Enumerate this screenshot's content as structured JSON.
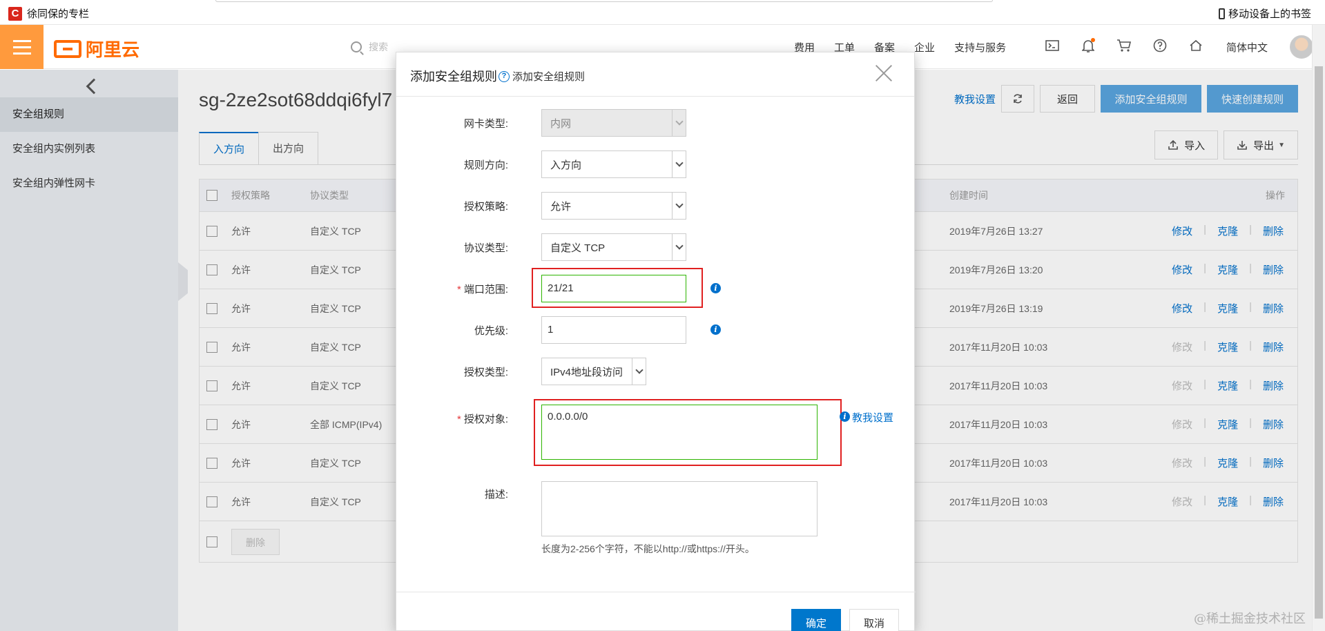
{
  "bookmarks": {
    "folder_label": "徐同保的专栏",
    "logo_letter": "C",
    "mobile_bookmarks": "移动设备上的书签"
  },
  "topnav": {
    "brand": "阿里云",
    "search_placeholder": "搜索",
    "links": [
      "费用",
      "工单",
      "备案",
      "企业",
      "支持与服务"
    ],
    "lang": "简体中文",
    "accent": "#ff6a00",
    "menu_bg": "#ff9a3d"
  },
  "sidebar": {
    "items": [
      "安全组规则",
      "安全组内实例列表",
      "安全组内弹性网卡"
    ],
    "active_index": 0
  },
  "main": {
    "sg_id": "sg-2ze2sot68ddqi6fyl7",
    "teach_link": "教我设置",
    "back_label": "返回",
    "add_rule_label": "添加安全组规则",
    "quick_rule_label": "快速创建规则",
    "tabs": [
      "入方向",
      "出方向"
    ],
    "import_label": "导入",
    "export_label": "导出",
    "columns": {
      "policy": "授权策略",
      "protocol": "协议类型",
      "created": "创建时间",
      "ops": "操作"
    },
    "rows": [
      {
        "policy": "允许",
        "protocol": "自定义 TCP",
        "created": "2019年7月26日 13:27",
        "edit_enabled": true
      },
      {
        "policy": "允许",
        "protocol": "自定义 TCP",
        "created": "2019年7月26日 13:20",
        "edit_enabled": true
      },
      {
        "policy": "允许",
        "protocol": "自定义 TCP",
        "created": "2019年7月26日 13:19",
        "edit_enabled": true
      },
      {
        "policy": "允许",
        "protocol": "自定义 TCP",
        "created": "2017年11月20日 10:03",
        "edit_enabled": false
      },
      {
        "policy": "允许",
        "protocol": "自定义 TCP",
        "created": "2017年11月20日 10:03",
        "edit_enabled": false
      },
      {
        "policy": "允许",
        "protocol": "全部 ICMP(IPv4)",
        "created": "2017年11月20日 10:03",
        "edit_enabled": false
      },
      {
        "policy": "允许",
        "protocol": "自定义 TCP",
        "created": "2017年11月20日 10:03",
        "edit_enabled": false
      },
      {
        "policy": "允许",
        "protocol": "自定义 TCP",
        "created": "2017年11月20日 10:03",
        "edit_enabled": false
      }
    ],
    "op_edit": "修改",
    "op_clone": "克隆",
    "op_delete": "删除",
    "bulk_delete": "删除"
  },
  "modal": {
    "title": "添加安全组规则",
    "help_label": "添加安全组规则",
    "fields": {
      "nic_type": {
        "label": "网卡类型:",
        "value": "内网"
      },
      "direction": {
        "label": "规则方向:",
        "value": "入方向"
      },
      "policy": {
        "label": "授权策略:",
        "value": "允许"
      },
      "protocol": {
        "label": "协议类型:",
        "value": "自定义 TCP"
      },
      "port_range": {
        "label": "端口范围:",
        "value": "21/21"
      },
      "priority": {
        "label": "优先级:",
        "value": "1"
      },
      "auth_type": {
        "label": "授权类型:",
        "value": "IPv4地址段访问"
      },
      "auth_object": {
        "label": "授权对象:",
        "value": "0.0.0.0/0",
        "teach": "教我设置"
      },
      "description": {
        "label": "描述:",
        "value": "",
        "hint": "长度为2-256个字符，不能以http://或https://开头。"
      }
    },
    "confirm_label": "确定",
    "cancel_label": "取消",
    "highlight_color": "#e02020"
  },
  "watermark": "@稀土掘金技术社区"
}
